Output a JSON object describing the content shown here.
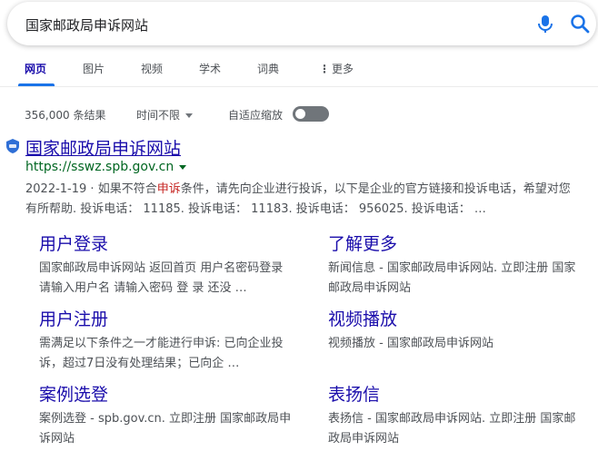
{
  "search": {
    "query": "国家邮政局申诉网站"
  },
  "tabs": [
    {
      "label": "网页"
    },
    {
      "label": "图片"
    },
    {
      "label": "视频"
    },
    {
      "label": "学术"
    },
    {
      "label": "词典"
    },
    {
      "label": "更多"
    }
  ],
  "tools": {
    "result_count": "356,000 条结果",
    "time_filter": "时间不限",
    "autozoom_label": "自适应缩放",
    "autozoom_on": false
  },
  "result": {
    "title": "国家邮政局申诉网站",
    "url": "https://sswz.spb.gov.cn",
    "date": "2022-1-19",
    "separator": " · ",
    "snippet_before": "如果不符合",
    "snippet_highlight": "申诉",
    "snippet_after": "条件，请先向企业进行投诉，以下是企业的官方链接和投诉电话，希望对您有所帮助. 投诉电话： 11185. 投诉电话： 11183. 投诉电话： 956025. 投诉电话： …"
  },
  "sitelinks": [
    {
      "title": "用户登录",
      "desc": "国家邮政局申诉网站 返回首页 用户名密码登录 请输入用户名 请输入密码 登 录 还没 …"
    },
    {
      "title": "了解更多",
      "desc": "新闻信息 - 国家邮政局申诉网站. 立即注册 国家邮政局申诉网站"
    },
    {
      "title": "用户注册",
      "desc": "需满足以下条件之一才能进行申诉: 已向企业投诉，超过7日没有处理结果；已向企 …"
    },
    {
      "title": "视频播放",
      "desc": "视频播放 - 国家邮政局申诉网站"
    },
    {
      "title": "案例选登",
      "desc": "案例选登 - spb.gov.cn. 立即注册 国家邮政局申诉网站"
    },
    {
      "title": "表扬信",
      "desc": "表扬信 - 国家邮政局申诉网站. 立即注册 国家邮政局申诉网站"
    }
  ],
  "colors": {
    "link": "#1a0dab",
    "url": "#006621",
    "highlight": "#c5221f",
    "accent": "#1a73e8"
  }
}
